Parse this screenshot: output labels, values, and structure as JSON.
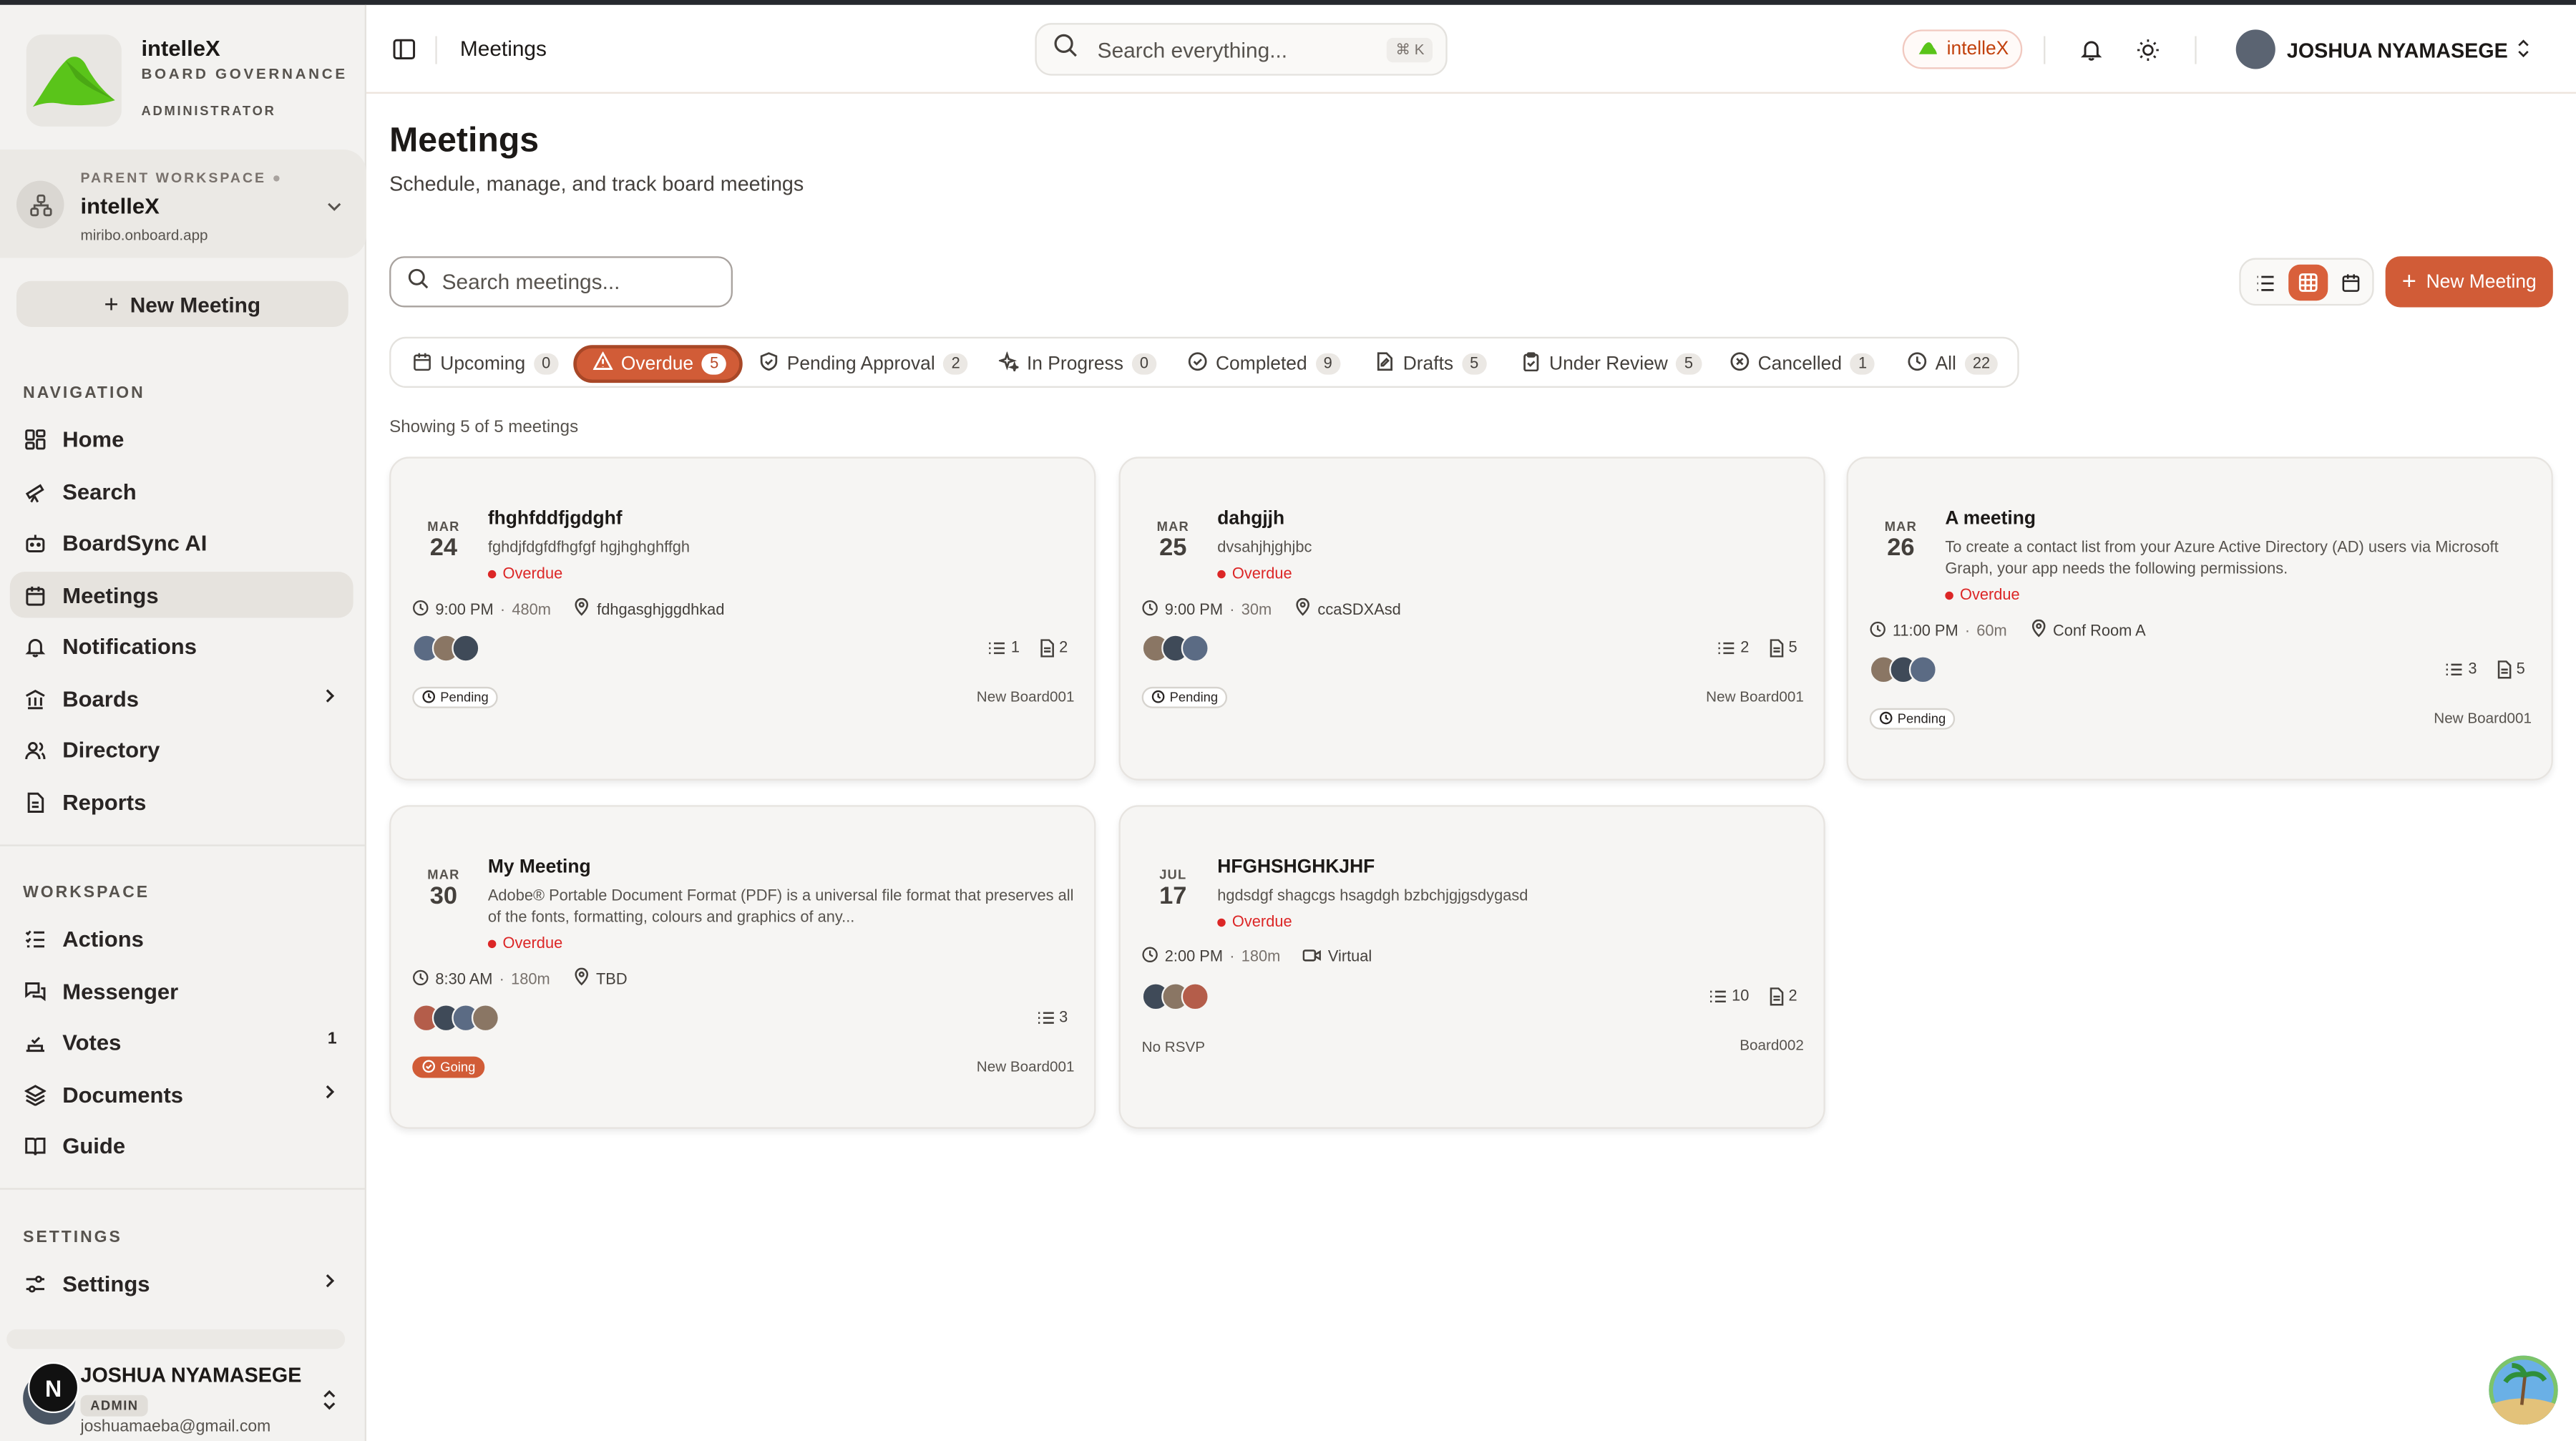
{
  "brand": {
    "name": "intelleX",
    "subtitle": "BOARD GOVERNANCE",
    "role": "ADMINISTRATOR"
  },
  "workspace": {
    "label": "PARENT WORKSPACE",
    "name": "intelleX",
    "url": "miribo.onboard.app"
  },
  "sidebar": {
    "new_meeting_label": "New Meeting",
    "navigation_label": "NAVIGATION",
    "nav": [
      {
        "label": "Home",
        "icon": "dashboard-icon"
      },
      {
        "label": "Search",
        "icon": "telescope-icon"
      },
      {
        "label": "BoardSync AI",
        "icon": "bot-icon"
      },
      {
        "label": "Meetings",
        "icon": "calendar-icon",
        "active": true
      },
      {
        "label": "Notifications",
        "icon": "bell-icon"
      },
      {
        "label": "Boards",
        "icon": "building-icon",
        "has_children": true
      },
      {
        "label": "Directory",
        "icon": "users-icon"
      },
      {
        "label": "Reports",
        "icon": "file-icon"
      }
    ],
    "workspace_label": "WORKSPACE",
    "workspace_items": [
      {
        "label": "Actions",
        "icon": "list-checks-icon"
      },
      {
        "label": "Messenger",
        "icon": "messages-icon"
      },
      {
        "label": "Votes",
        "icon": "vote-icon",
        "badge": "1"
      },
      {
        "label": "Documents",
        "icon": "layers-icon",
        "has_children": true
      },
      {
        "label": "Guide",
        "icon": "book-icon"
      }
    ],
    "settings_label": "SETTINGS",
    "settings_items": [
      {
        "label": "Settings",
        "icon": "sliders-icon",
        "has_children": true
      }
    ],
    "user": {
      "initial": "N",
      "name": "JOSHUA NYAMASEGE",
      "role": "ADMIN",
      "email": "joshuamaeba@gmail.com"
    }
  },
  "topbar": {
    "breadcrumb": "Meetings",
    "search_placeholder": "Search everything...",
    "search_shortcut": "⌘ K",
    "org_pill": "intelleX",
    "user_name": "JOSHUA NYAMASEGE"
  },
  "main": {
    "title": "Meetings",
    "subtitle": "Schedule, manage, and track board meetings",
    "search_placeholder": "Search meetings...",
    "new_meeting_label": "New Meeting",
    "showing": "Showing 5 of 5 meetings",
    "tabs": [
      {
        "label": "Upcoming",
        "count": "0",
        "icon": "calendar-icon"
      },
      {
        "label": "Overdue",
        "count": "5",
        "icon": "alert-triangle-icon",
        "active": true
      },
      {
        "label": "Pending Approval",
        "count": "2",
        "icon": "shield-check-icon"
      },
      {
        "label": "In Progress",
        "count": "0",
        "icon": "sparkles-icon"
      },
      {
        "label": "Completed",
        "count": "9",
        "icon": "check-circle-icon"
      },
      {
        "label": "Drafts",
        "count": "5",
        "icon": "file-edit-icon"
      },
      {
        "label": "Under Review",
        "count": "5",
        "icon": "clipboard-check-icon"
      },
      {
        "label": "Cancelled",
        "count": "1",
        "icon": "x-circle-icon"
      },
      {
        "label": "All",
        "count": "22",
        "icon": "clock-icon"
      }
    ]
  },
  "meetings": [
    {
      "month": "MAR",
      "day": "24",
      "title": "fhghfddfjgdghf",
      "description": "fghdjfdgfdfhgfgf hgjhghghffgh",
      "status": "Overdue",
      "time": "9:00 PM",
      "duration": "480m",
      "location": "fdhgasghjggdhkad",
      "location_icon": "map-pin-icon",
      "agenda_count": "1",
      "doc_count": "2",
      "rsvp": "Pending",
      "board": "New Board001"
    },
    {
      "month": "MAR",
      "day": "25",
      "title": "dahgjjh",
      "description": "dvsahjhjghjbc",
      "status": "Overdue",
      "time": "9:00 PM",
      "duration": "30m",
      "location": "ccaSDXAsd",
      "location_icon": "map-pin-icon",
      "agenda_count": "2",
      "doc_count": "5",
      "rsvp": "Pending",
      "board": "New Board001"
    },
    {
      "month": "MAR",
      "day": "26",
      "title": "A meeting",
      "description": "To create a contact list from your Azure Active Directory (AD) users via Microsoft Graph, your app needs the following permissions.",
      "status": "Overdue",
      "time": "11:00 PM",
      "duration": "60m",
      "location": "Conf Room A",
      "location_icon": "map-pin-icon",
      "agenda_count": "3",
      "doc_count": "5",
      "rsvp": "Pending",
      "board": "New Board001"
    },
    {
      "month": "MAR",
      "day": "30",
      "title": "My Meeting",
      "description": "Adobe® Portable Document Format (PDF) is a universal file format that preserves all of the fonts, formatting, colours and graphics of any...",
      "status": "Overdue",
      "time": "8:30 AM",
      "duration": "180m",
      "location": "TBD",
      "location_icon": "map-pin-icon",
      "agenda_count": "3",
      "rsvp": "Going",
      "board": "New Board001"
    },
    {
      "month": "JUL",
      "day": "17",
      "title": "HFGHSHGHKJHF",
      "description": "hgdsdgf shagcgs hsagdgh bzbchjgjgsdygasd",
      "status": "Overdue",
      "time": "2:00 PM",
      "duration": "180m",
      "location": "Virtual",
      "location_icon": "video-icon",
      "agenda_count": "10",
      "doc_count": "2",
      "rsvp": "No RSVP",
      "board": "Board002"
    }
  ],
  "colors": {
    "accent": "#d15c37",
    "overdue": "#dc2626",
    "sidebar_bg": "#f3f2f0",
    "card_bg": "#f6f5f3"
  }
}
